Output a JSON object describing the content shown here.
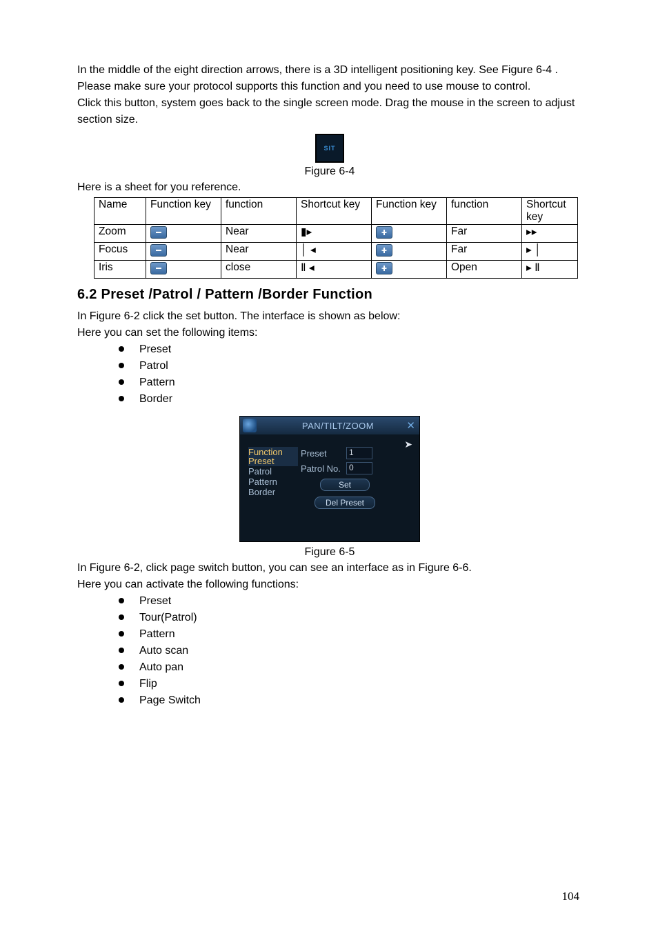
{
  "para1": "In the middle of the eight direction arrows, there is a 3D intelligent positioning key. See Figure 6-4 . Please make sure your protocol supports this function and you need to use mouse to control.",
  "para2": "Click this button, system goes back to the single screen mode. Drag the mouse in the screen to adjust section size.",
  "sit_label": "SIT",
  "fig64": "Figure 6-4",
  "sheet_intro": "Here is a sheet for you reference.",
  "sheet": {
    "head": [
      "Name",
      "Function key",
      "function",
      "Shortcut key",
      "Function key",
      "function",
      "Shortcut key"
    ],
    "rows": [
      {
        "name": "Zoom",
        "f1": "minus",
        "fn1": "Near",
        "sk1": "▮▸",
        "f2": "plus",
        "fn2": "Far",
        "sk2": "▸▸"
      },
      {
        "name": "Focus",
        "f1": "minus",
        "fn1": "Near",
        "sk1": "│ ◂",
        "f2": "plus",
        "fn2": "Far",
        "sk2": "▸ │"
      },
      {
        "name": "Iris",
        "f1": "minus",
        "fn1": "close",
        "sk1": "Ⅱ ◂",
        "f2": "plus",
        "fn2": "Open",
        "sk2": "▸ Ⅱ"
      }
    ]
  },
  "h2": "6.2  Preset  /Patrol / Pattern /Border  Function",
  "para3": "In Figure 6-2 click the set button. The interface is shown as below:",
  "para4": "Here you can set the following items:",
  "list1": [
    "Preset",
    "Patrol",
    "Pattern",
    "Border"
  ],
  "ptz": {
    "title": "PAN/TILT/ZOOM",
    "function_lbl": "Function",
    "preset_lbl": "Preset",
    "preset_val": "1",
    "patrol_lbl": "Patrol No.",
    "patrol_val": "0",
    "set_btn": "Set",
    "del_btn": "Del Preset",
    "items": [
      "Preset",
      "Patrol",
      "Pattern",
      "Border"
    ]
  },
  "fig65": "Figure 6-5",
  "para5": "In Figure 6-2, click page switch button, you can see an interface as in Figure 6-6.",
  "para6": "Here you can activate the following functions:",
  "list2": [
    "Preset",
    "Tour(Patrol)",
    "Pattern",
    "Auto scan",
    "Auto pan",
    "Flip",
    "Page Switch"
  ],
  "page_number": "104"
}
